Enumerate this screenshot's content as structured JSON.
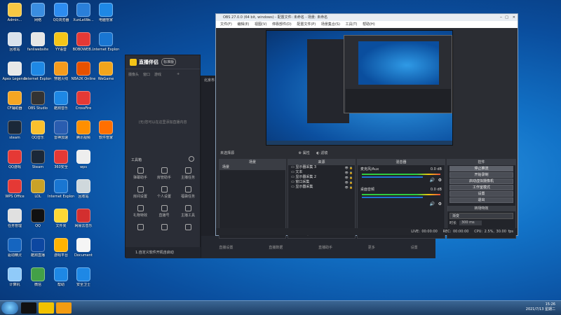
{
  "desktop_icons": [
    {
      "label": "Admin...",
      "color": "#f7c843"
    },
    {
      "label": "网络",
      "color": "#3a8de0"
    },
    {
      "label": "QQ浏览器",
      "color": "#2d8cf0"
    },
    {
      "label": "XunLeiWe...",
      "color": "#2a7fd9"
    },
    {
      "label": "电脑管家",
      "color": "#1e88e5"
    },
    {
      "label": "回收站",
      "color": "#d9e2ec"
    },
    {
      "label": "fanliwebsite",
      "color": "#e6e6e6"
    },
    {
      "label": "YY语音",
      "color": "#f5c518"
    },
    {
      "label": "BOBOWEB...",
      "color": "#e53935"
    },
    {
      "label": "Internet Explorer",
      "color": "#1976d2"
    },
    {
      "label": "Apex Legends",
      "color": "#e8e8e8"
    },
    {
      "label": "Internet Explorer",
      "color": "#1e88e5"
    },
    {
      "label": "穿越火线",
      "color": "#f59b1c"
    },
    {
      "label": "NBA2K Online",
      "color": "#e65100"
    },
    {
      "label": "WeGame",
      "color": "#f2a51c"
    },
    {
      "label": "CF辅助器",
      "color": "#f5a623"
    },
    {
      "label": "OBS Studio",
      "color": "#333333"
    },
    {
      "label": "酷狗音乐",
      "color": "#1e88e5"
    },
    {
      "label": "CrossFire",
      "color": "#e53935"
    },
    {
      "label": "steam",
      "color": "#1b2838"
    },
    {
      "label": "QQ音乐",
      "color": "#fbc02d"
    },
    {
      "label": "雷神加速",
      "color": "#2a5db0"
    },
    {
      "label": "腾讯视频",
      "color": "#ff8f00"
    },
    {
      "label": "软件管家",
      "color": "#ff6f00"
    },
    {
      "label": "QQ游戏",
      "color": "#e53935"
    },
    {
      "label": "Steam",
      "color": "#1b2838"
    },
    {
      "label": "360安全",
      "color": "#e53935"
    },
    {
      "label": "wps",
      "color": "#eeeeee"
    },
    {
      "label": "WPS Office",
      "color": "#e53935"
    },
    {
      "label": "LOL",
      "color": "#c9a227"
    },
    {
      "label": "Internet Explorer",
      "color": "#1976d2"
    },
    {
      "label": "回收站",
      "color": "#cfd8dc"
    },
    {
      "label": "任务管理",
      "color": "#e0e0e0"
    },
    {
      "label": "QQ",
      "color": "#111111"
    },
    {
      "label": "文件夹",
      "color": "#fdd835"
    },
    {
      "label": "网易云音乐",
      "color": "#d32f2f"
    },
    {
      "label": "驱动精灵",
      "color": "#1565c0"
    },
    {
      "label": "酷狗直播",
      "color": "#0d47a1"
    },
    {
      "label": "游戏平台",
      "color": "#ffb300"
    },
    {
      "label": "Document",
      "color": "#f5f5f5"
    },
    {
      "label": "计算机",
      "color": "#90caf9"
    },
    {
      "label": "微信",
      "color": "#43a047"
    },
    {
      "label": "帮助",
      "color": "#1e88e5"
    },
    {
      "label": "安全卫士",
      "color": "#1e88e5"
    }
  ],
  "taskbar": {
    "time": "15:26",
    "date": "2021/7/13 星期二",
    "pinned": [
      "#111111",
      "#f2c200",
      "#f39c12"
    ]
  },
  "left_app": {
    "logo": "直播伴侣",
    "badge": "标准版",
    "tabs": [
      "摄像头",
      "窗口",
      "游戏",
      ""
    ],
    "empty_hint": "(无)您可以在这里添加直播内容",
    "side_label": "北京市",
    "toolbox_title": "工具箱",
    "tools": [
      [
        "弹幕助手",
        "房管助手",
        "主播任务"
      ],
      [
        "房间设置",
        "个人设置",
        "福袋任务"
      ],
      [
        "礼物特效",
        "直播号",
        "主播工具"
      ],
      [
        "",
        "",
        ""
      ]
    ],
    "footer": "1.自定义软件开机自启动"
  },
  "obs": {
    "title": "OBS 27.0.0 (64 bit, windows) - 配置文件: 未命名 - 场景: 未命名",
    "menu": [
      "文件(F)",
      "编辑(E)",
      "视图(V)",
      "停靠部件(D)",
      "配置文件(P)",
      "场景集合(S)",
      "工具(T)",
      "帮助(H)"
    ],
    "source_bar": "未选择源",
    "prop_btn": "属性",
    "filter_btn": "滤镜",
    "docks": {
      "scenes": {
        "title": "场景",
        "items": [
          "场景"
        ]
      },
      "sources": {
        "title": "来源",
        "items": [
          "显示器采集 3",
          "文本",
          "显示器采集 2",
          "窗口采集",
          "显示器采集"
        ]
      },
      "mixer": {
        "title": "混音器",
        "tracks": [
          {
            "name": "麦克风/Aux",
            "level": "0.0 dB"
          },
          {
            "name": "桌面音频",
            "level": "0.0 dB"
          }
        ]
      },
      "transitions": {
        "title": "转场特效",
        "type": "渐变",
        "duration_label": "时长",
        "duration": "300 ms"
      },
      "controls": {
        "title": "控件",
        "buttons": [
          "停止推流",
          "开始录制",
          "启动虚拟摄像机",
          "工作室模式",
          "设置",
          "退出"
        ]
      }
    },
    "status": [
      "LIVE: 00:00:00",
      "REC: 00:00:00",
      "CPU: 2.5%, 30.00 fps"
    ]
  },
  "dark_strip_labels": [
    "直播设置",
    "直播数据",
    "直播助手",
    "更多",
    "设置"
  ]
}
